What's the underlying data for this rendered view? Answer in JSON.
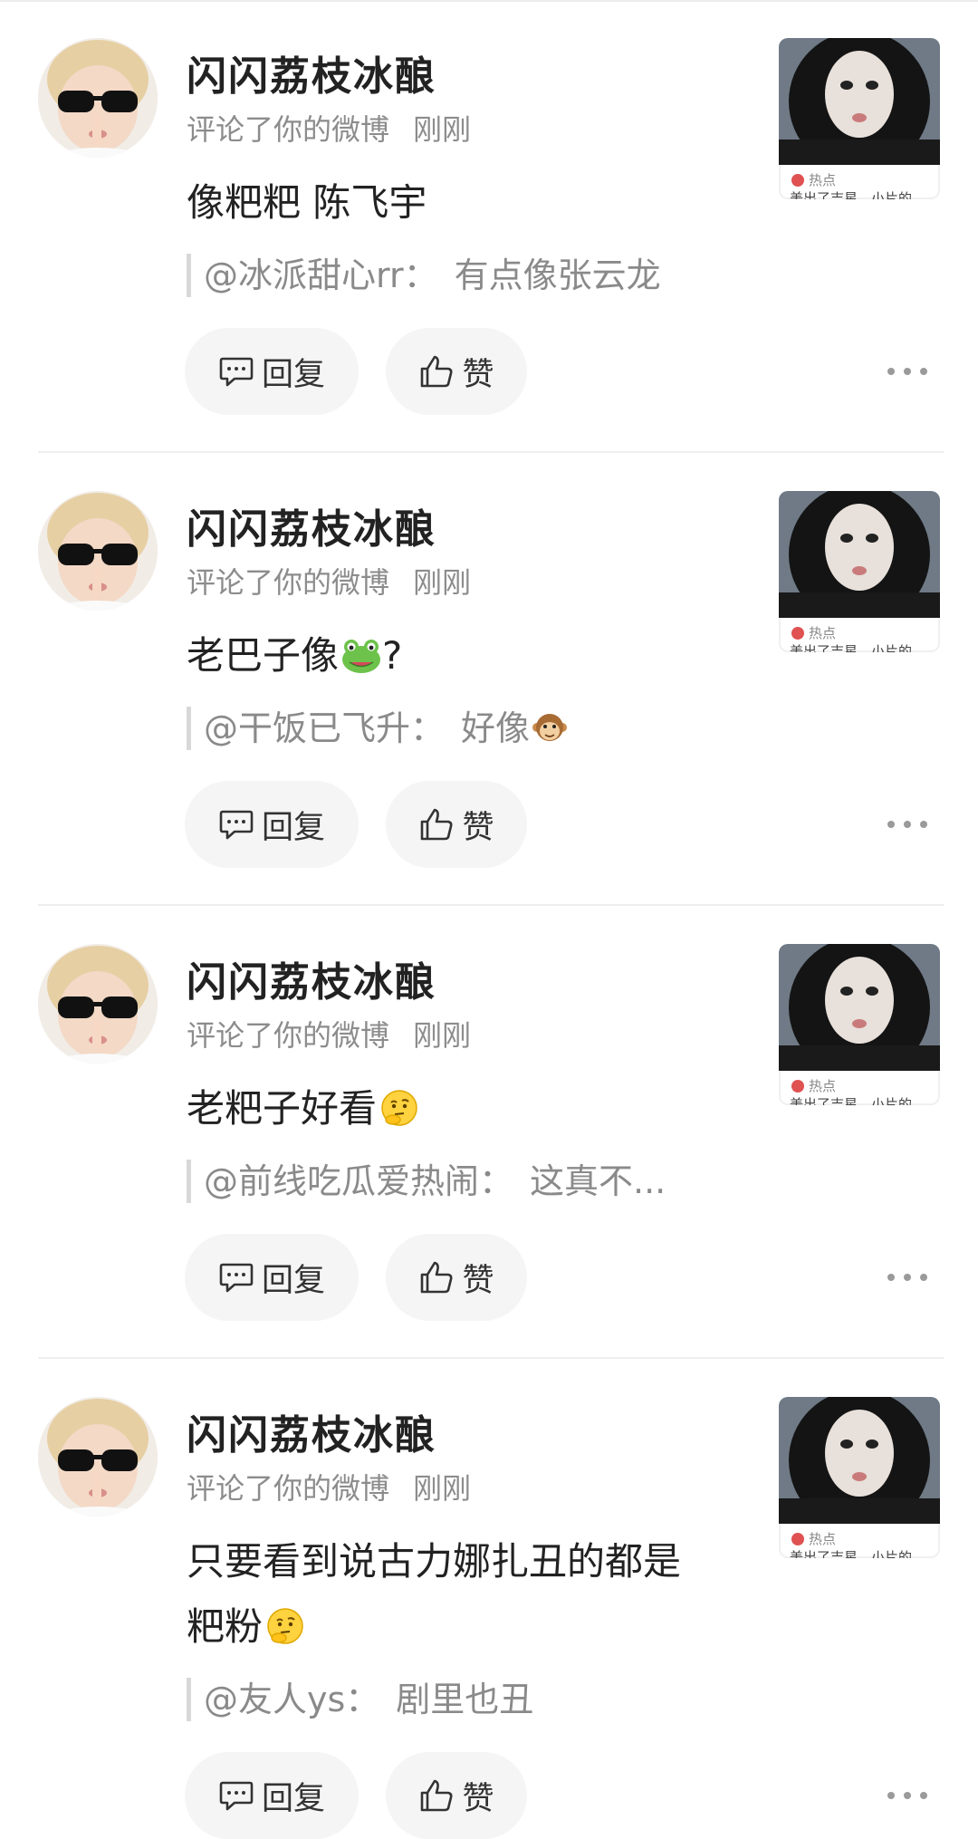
{
  "notifications": [
    {
      "username": "闪闪荔枝冰酿",
      "action": "评论了你的微博",
      "time": "刚刚",
      "comment_lines": [
        "像粑粑 陈飞宇"
      ],
      "comment_emoji": "",
      "quote_user": "@冰派甜心rr：",
      "quote_text": "有点像张云龙",
      "quote_emoji": "",
      "reply_label": "回复",
      "like_label": "赞",
      "thumb_tag": "热点",
      "thumb_caption": "美出了吉星…小片的"
    },
    {
      "username": "闪闪荔枝冰酿",
      "action": "评论了你的微博",
      "time": "刚刚",
      "comment_lines": [
        "老巴子像"
      ],
      "comment_emoji": "frog-emoji",
      "comment_suffix": "?",
      "quote_user": "@干饭已飞升：",
      "quote_text": "好像",
      "quote_emoji": "monkey-emoji",
      "reply_label": "回复",
      "like_label": "赞",
      "thumb_tag": "热点",
      "thumb_caption": "美出了吉星…小片的"
    },
    {
      "username": "闪闪荔枝冰酿",
      "action": "评论了你的微博",
      "time": "刚刚",
      "comment_lines": [
        "老粑子好看"
      ],
      "comment_emoji": "thinking-emoji",
      "quote_user": "@前线吃瓜爱热闹：",
      "quote_text": "这真不...",
      "quote_emoji": "",
      "reply_label": "回复",
      "like_label": "赞",
      "thumb_tag": "热点",
      "thumb_caption": "美出了吉星…小片的"
    },
    {
      "username": "闪闪荔枝冰酿",
      "action": "评论了你的微博",
      "time": "刚刚",
      "comment_lines": [
        "只要看到说古力娜扎丑的都是",
        "粑粉"
      ],
      "comment_emoji": "thinking-emoji",
      "quote_user": "@友人ys：",
      "quote_text": "剧里也丑",
      "quote_emoji": "",
      "reply_label": "回复",
      "like_label": "赞",
      "thumb_tag": "热点",
      "thumb_caption": "美出了吉星…小片的"
    }
  ],
  "colors": {
    "button_bg": "#f5f5f5",
    "meta_text": "#8c8c8c",
    "quote_text": "#8a8a8a",
    "divider": "#eeeeee"
  }
}
